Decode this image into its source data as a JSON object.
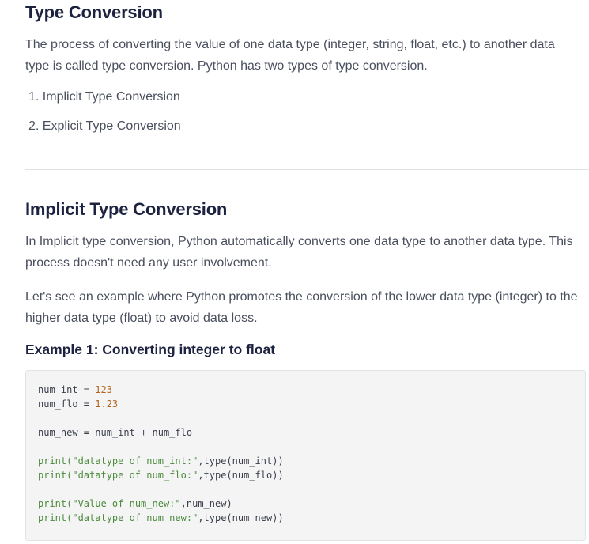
{
  "section1": {
    "title": "Type Conversion",
    "paragraph": "The process of converting the value of one data type (integer, string, float, etc.) to another data type is called type conversion. Python has two types of type conversion.",
    "list": [
      "1. Implicit Type Conversion",
      "2. Explicit Type Conversion"
    ]
  },
  "section2": {
    "title": "Implicit Type Conversion",
    "paragraph1": "In Implicit type conversion, Python automatically converts one data type to another data type. This process doesn't need any user involvement.",
    "paragraph2": "Let's see an example where Python promotes the conversion of the lower data type (integer) to the higher data type (float) to avoid data loss.",
    "example_title": "Example 1: Converting integer to float"
  },
  "code": {
    "line1_a": "num_int = ",
    "line1_b": "123",
    "line2_a": "num_flo = ",
    "line2_b": "1.23",
    "line4": "num_new = num_int + num_flo",
    "line6_fn": "print(",
    "line6_str": "\"datatype of num_int:\"",
    "line6_rest": ",type(num_int))",
    "line7_fn": "print(",
    "line7_str": "\"datatype of num_flo:\"",
    "line7_rest": ",type(num_flo))",
    "line9_fn": "print(",
    "line9_str": "\"Value of num_new:\"",
    "line9_rest": ",num_new)",
    "line10_fn": "print(",
    "line10_str": "\"datatype of num_new:\"",
    "line10_rest": ",type(num_new))"
  },
  "colors": {
    "heading": "#1d2240",
    "body_text": "#4a4f5e",
    "code_bg": "#f4f4f5",
    "code_number": "#b5651d",
    "code_string": "#4b8b3b"
  }
}
